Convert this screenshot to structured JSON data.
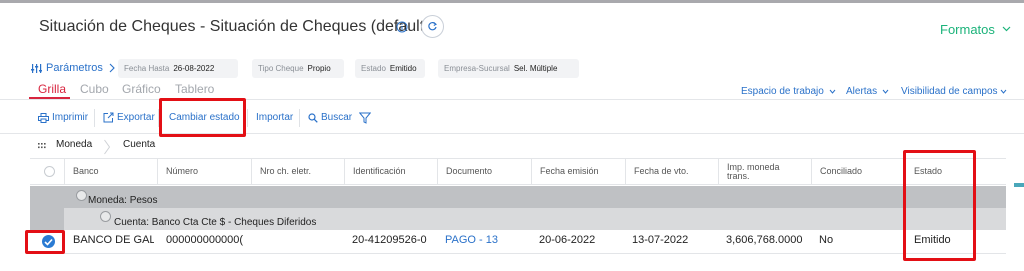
{
  "page": {
    "title": "Situación de Cheques - Situación de Cheques (default)",
    "formatos_label": "Formatos"
  },
  "filters": {
    "parametros_label": "Parámetros",
    "chips": [
      {
        "key": "Fecha Hasta",
        "value": "26-08-2022"
      },
      {
        "key": "Tipo Cheque",
        "value": "Propio"
      },
      {
        "key": "Estado",
        "value": "Emitido"
      },
      {
        "key": "Empresa-Sucursal",
        "value": "Sel. Múltiple"
      }
    ]
  },
  "tabs": [
    "Grilla",
    "Cubo",
    "Gráfico",
    "Tablero"
  ],
  "right_links": [
    "Espacio de trabajo",
    "Alertas",
    "Visibilidad de campos"
  ],
  "toolbar": {
    "imprimir": "Imprimir",
    "exportar": "Exportar",
    "cambiar_estado": "Cambiar estado",
    "importar": "Importar",
    "buscar": "Buscar"
  },
  "grouping": [
    "Moneda",
    "Cuenta"
  ],
  "table": {
    "columns": [
      "Banco",
      "Número",
      "Nro ch. eletr.",
      "Identificación",
      "Documento",
      "Fecha emisión",
      "Fecha de vto.",
      "Imp. moneda trans.",
      "Conciliado",
      "Estado"
    ],
    "group_level1": "Moneda: Pesos",
    "group_level2": "Cuenta: Banco Cta Cte $ - Cheques Diferidos",
    "rows": [
      {
        "banco": "BANCO DE GALI",
        "numero": "000000000000(",
        "nro_ch_eletr": "",
        "identificacion": "20-41209526-0",
        "documento": "PAGO - 13",
        "fecha_emision": "20-06-2022",
        "fecha_vto": "13-07-2022",
        "importe": "3,606,768.0000",
        "conciliado": "No",
        "estado": "Emitido"
      }
    ]
  },
  "colors": {
    "accent_blue": "#2a71c9",
    "formatos_green": "#1bb37a",
    "active_tab_red": "#d8253f",
    "highlight_red": "#e30f15"
  }
}
